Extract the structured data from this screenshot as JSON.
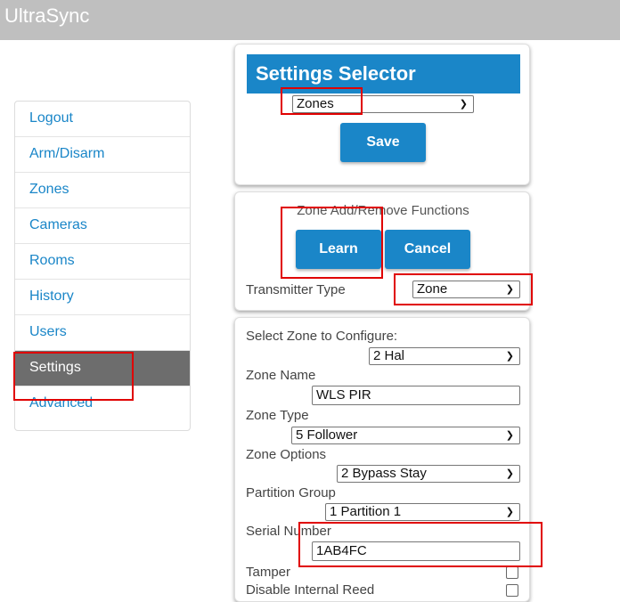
{
  "app": {
    "title": "UltraSync"
  },
  "sidebar": {
    "items": [
      {
        "label": "Logout"
      },
      {
        "label": "Arm/Disarm"
      },
      {
        "label": "Zones"
      },
      {
        "label": "Cameras"
      },
      {
        "label": "Rooms"
      },
      {
        "label": "History"
      },
      {
        "label": "Users"
      },
      {
        "label": "Settings",
        "active": true
      },
      {
        "label": "Advanced"
      }
    ]
  },
  "settings_selector": {
    "title": "Settings Selector",
    "selected": "Zones",
    "save_label": "Save"
  },
  "zone_functions": {
    "title": "Zone Add/Remove Functions",
    "learn_label": "Learn",
    "cancel_label": "Cancel",
    "transmitter_type_label": "Transmitter Type",
    "transmitter_type_value": "Zone"
  },
  "zone_config": {
    "select_zone_label": "Select Zone to Configure:",
    "select_zone_value": "2 Hal",
    "zone_name_label": "Zone Name",
    "zone_name_value": "WLS PIR",
    "zone_type_label": "Zone Type",
    "zone_type_value": "5 Follower",
    "zone_options_label": "Zone Options",
    "zone_options_value": "2 Bypass Stay",
    "partition_group_label": "Partition Group",
    "partition_group_value": "1 Partition 1",
    "serial_number_label": "Serial Number",
    "serial_number_value": "1AB4FC",
    "tamper_label": "Tamper",
    "disable_internal_reed_label": "Disable Internal Reed"
  },
  "colors": {
    "accent": "#1a86c8",
    "topbar": "#bfbfbf",
    "active_nav": "#6d6d6d",
    "highlight": "#e00000"
  },
  "icons": {
    "dropdown": "chevron-down-icon"
  }
}
